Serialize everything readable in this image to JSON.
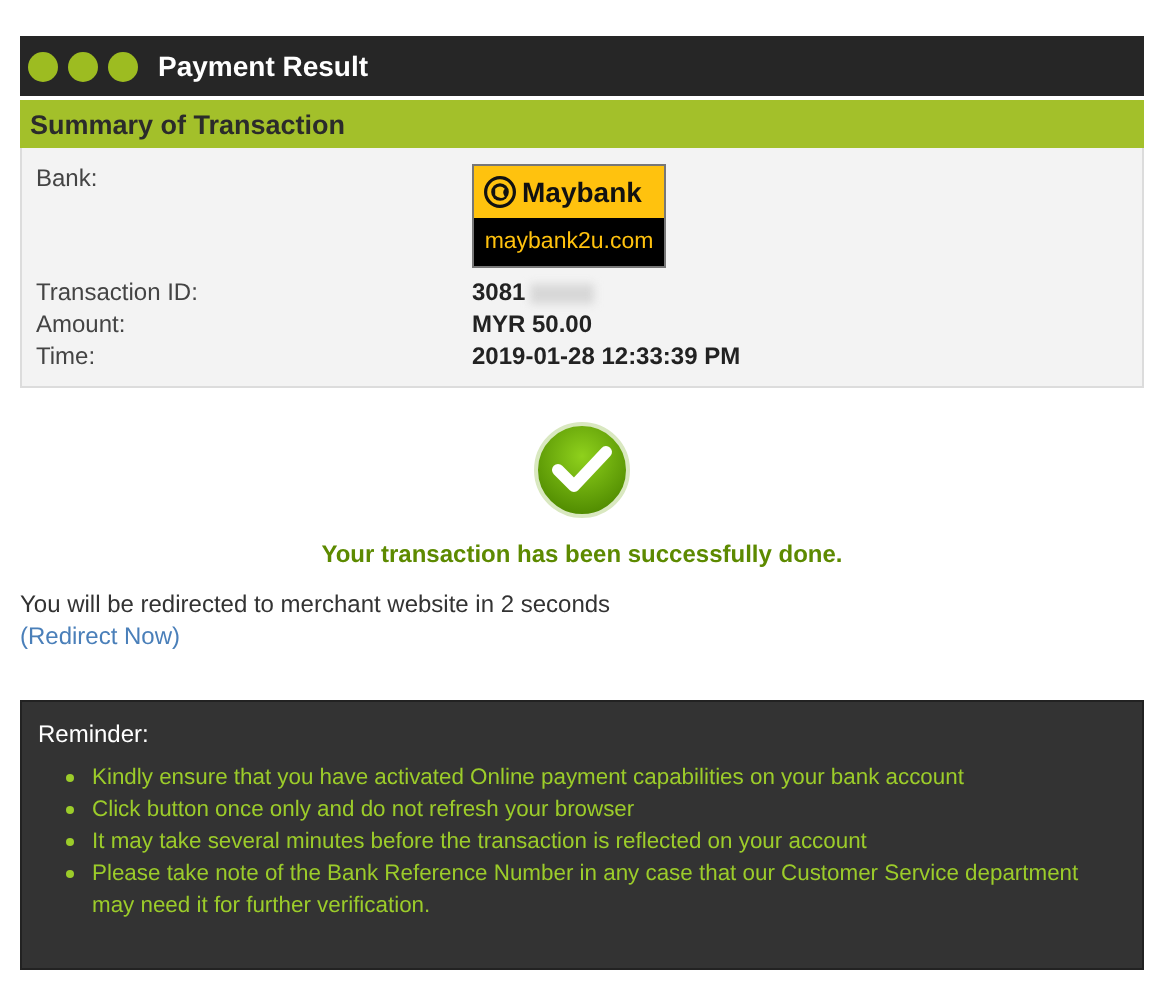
{
  "window": {
    "title": "Payment Result"
  },
  "summary": {
    "title": "Summary of Transaction",
    "bank": {
      "label": "Bank:",
      "logo_name": "Maybank",
      "logo_url": "maybank2u.com"
    },
    "fields": [
      {
        "label": "Transaction ID:",
        "value": "3081",
        "redacted": true
      },
      {
        "label": "Amount:",
        "value": "MYR 50.00",
        "redacted": false
      },
      {
        "label": "Time:",
        "value": "2019-01-28 12:33:39 PM",
        "redacted": false
      }
    ]
  },
  "result": {
    "kind": "success",
    "message": "Your transaction has been successfully done."
  },
  "redirect": {
    "text": "You will be redirected to merchant website in 2 seconds",
    "link": "(Redirect Now)"
  },
  "reminder": {
    "title": "Reminder:",
    "items": [
      "Kindly ensure that you have activated Online payment capabilities on your bank account",
      "Click button once only and do not refresh your browser",
      "It may take several minutes before the transaction is reflected on your account",
      "Please take note of the Bank Reference Number in any case that our Customer Service department may need it for further verification."
    ]
  }
}
